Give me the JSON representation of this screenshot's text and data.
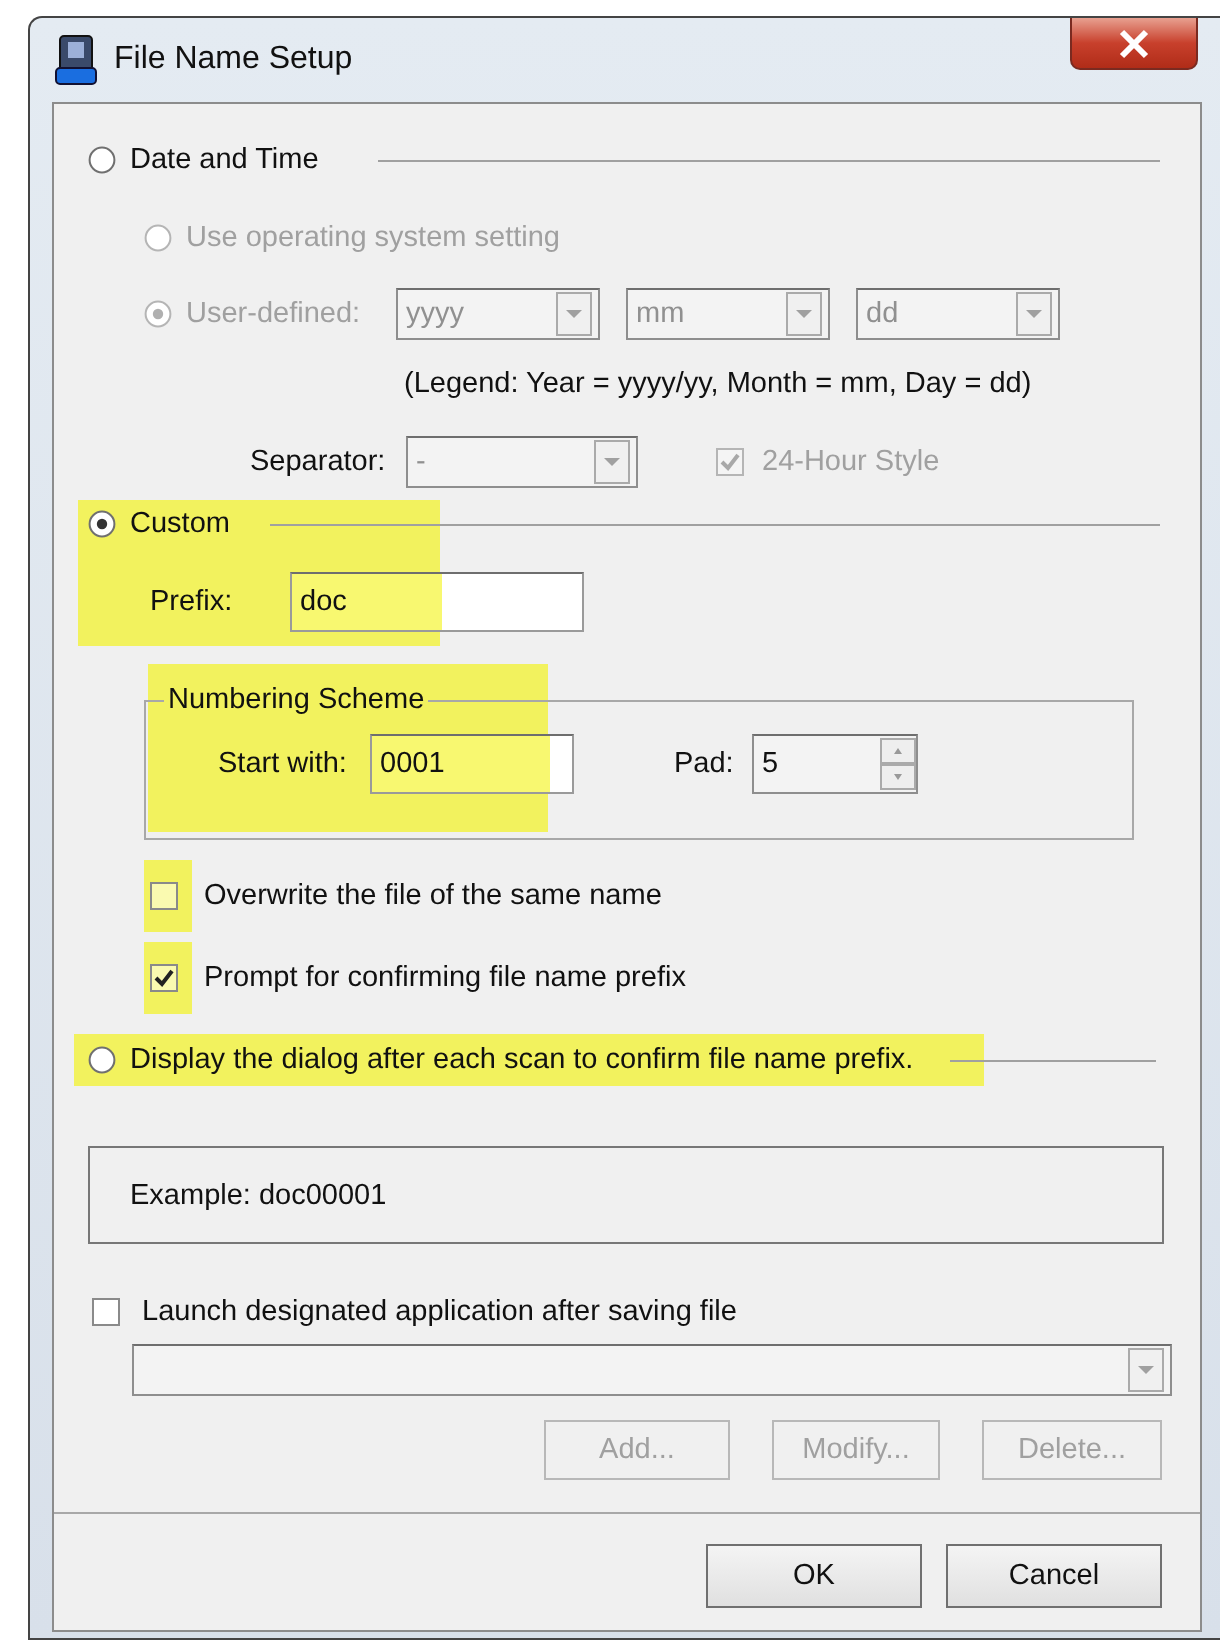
{
  "window": {
    "title": "File Name Setup"
  },
  "date_time": {
    "label": "Date and Time",
    "selected": false,
    "use_os": {
      "label": "Use operating system setting",
      "selected": false,
      "disabled": true
    },
    "user_defined": {
      "label": "User-defined:",
      "selected": true,
      "disabled": true,
      "combos": [
        {
          "value": "yyyy"
        },
        {
          "value": "mm"
        },
        {
          "value": "dd"
        }
      ]
    },
    "legend": "(Legend:  Year = yyyy/yy, Month = mm, Day = dd)",
    "separator": {
      "label": "Separator:",
      "value": "-",
      "disabled": true
    },
    "hour24": {
      "label": "24-Hour Style",
      "checked": true,
      "disabled": true
    }
  },
  "custom": {
    "label": "Custom",
    "selected": true,
    "highlighted": true,
    "prefix": {
      "label": "Prefix:",
      "value": "doc"
    },
    "numbering": {
      "title": "Numbering Scheme",
      "highlighted": true,
      "start_with": {
        "label": "Start with:",
        "value": "0001"
      },
      "pad": {
        "label": "Pad:",
        "value": "5"
      }
    },
    "options": [
      {
        "label": "Overwrite the file of the same name",
        "checked": false,
        "highlighted": true
      },
      {
        "label": "Prompt for confirming file name prefix",
        "checked": true,
        "highlighted": true
      }
    ]
  },
  "display_dialog": {
    "label": "Display the dialog after each scan to confirm file name prefix.",
    "selected": false,
    "highlighted": true
  },
  "example": "Example: doc00001",
  "launch": {
    "label": "Launch designated application after saving file",
    "checked": false
  },
  "application": {
    "disabled": true
  },
  "app_buttons": [
    {
      "label": "Add...",
      "disabled": true
    },
    {
      "label": "Modify...",
      "disabled": true
    },
    {
      "label": "Delete...",
      "disabled": true
    }
  ],
  "buttons": [
    {
      "label": "OK"
    },
    {
      "label": "Cancel"
    }
  ]
}
